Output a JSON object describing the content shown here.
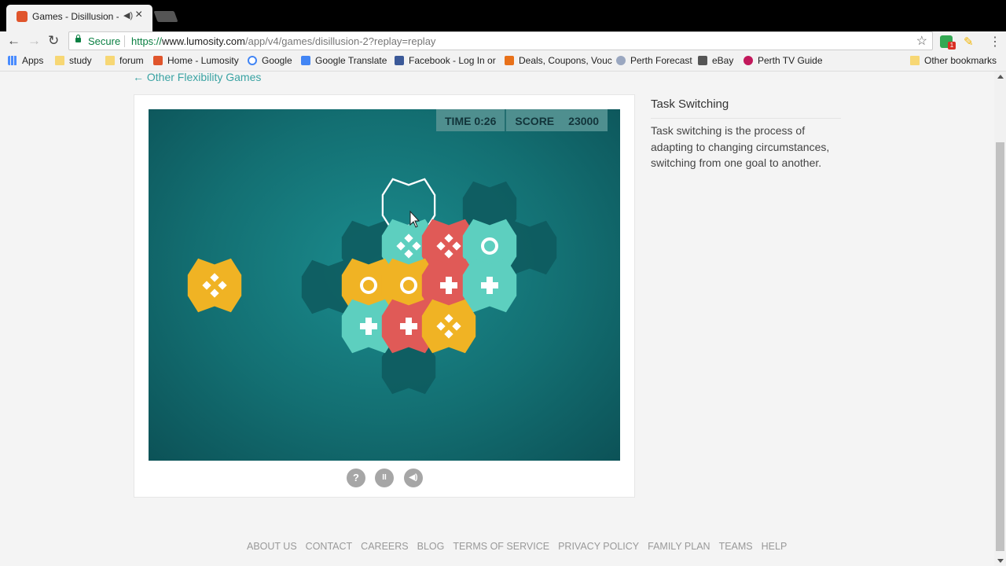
{
  "browser": {
    "tab": {
      "title": "Games - Disillusion - Lumosity",
      "audio_icon": "speaker-icon",
      "close_glyph": "×"
    },
    "nav": {
      "back": "←",
      "forward": "→",
      "reload": "↻"
    },
    "omnibox": {
      "secure_label": "Secure",
      "url_scheme": "https://",
      "url_host": "www.lumosity.com",
      "url_path": "/app/v4/games/disillusion-2?replay=replay"
    },
    "bookmarks": [
      {
        "label": "Apps",
        "icon": "apps-grid-icon"
      },
      {
        "label": "study",
        "icon": "folder-icon"
      },
      {
        "label": "forum",
        "icon": "folder-icon"
      },
      {
        "label": "Home - Lumosity",
        "icon": "lumosity-icon"
      },
      {
        "label": "Google",
        "icon": "google-icon"
      },
      {
        "label": "Google Translate",
        "icon": "translate-icon"
      },
      {
        "label": "Facebook - Log In or",
        "icon": "facebook-icon"
      },
      {
        "label": "Deals, Coupons, Vouc",
        "icon": "ozbargain-icon"
      },
      {
        "label": "Perth Forecast",
        "icon": "weather-icon"
      },
      {
        "label": "eBay",
        "icon": "ebay-icon"
      },
      {
        "label": "Perth TV Guide",
        "icon": "tvguide-icon"
      }
    ],
    "other_bookmarks": "Other bookmarks"
  },
  "page": {
    "back_link": "← Other Flexibility Games",
    "hud": {
      "time_label": "TIME 0:26",
      "score_label": "SCORE",
      "score_value": "23000"
    },
    "controls": [
      {
        "name": "help-button",
        "glyph": "?"
      },
      {
        "name": "pause-button",
        "glyph": "II"
      },
      {
        "name": "sound-button",
        "glyph": "◀)"
      }
    ],
    "sidebar": {
      "title": "Task Switching",
      "description": "Task switching is the process of adapting to changing circumstances, switching from one goal to another."
    },
    "footer": [
      "ABOUT US",
      "CONTACT",
      "CAREERS",
      "BLOG",
      "TERMS OF SERVICE",
      "PRIVACY POLICY",
      "FAMILY PLAN",
      "TEAMS",
      "HELP"
    ]
  },
  "colors": {
    "teal": "#5dcfbf",
    "red": "#e05a57",
    "yellow": "#f0b324",
    "board": "#136f72",
    "link": "#3aa3a3"
  }
}
